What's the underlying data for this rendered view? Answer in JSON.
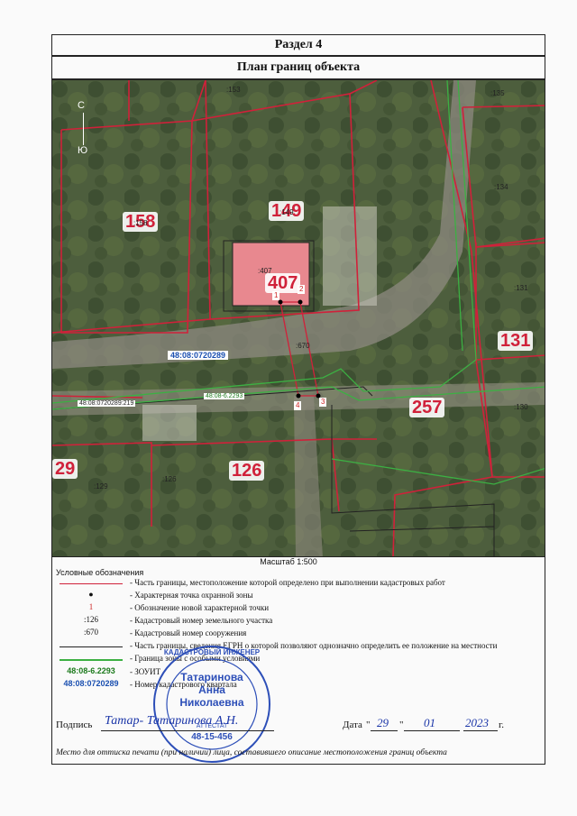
{
  "section_title": "Раздел 4",
  "plan_title": "План границ объекта",
  "compass": {
    "north": "С",
    "south": "Ю"
  },
  "map": {
    "parcel_labels": [
      {
        "big": "158",
        "small": ":158"
      },
      {
        "big": "149",
        "small": ":149"
      },
      {
        "big": "407",
        "small": ":407"
      },
      {
        "big": "131",
        "small": ":131"
      },
      {
        "big": "257",
        "small": ""
      },
      {
        "big": "126",
        "small": ":126"
      },
      {
        "big": "29",
        "small": ""
      }
    ],
    "small_labels": [
      ":153",
      ":135",
      ":134",
      ":130",
      ":129",
      ":670"
    ],
    "quarter_number": "48:08:0720289",
    "quarter_number_small": "48:08:0720289:219",
    "zone_number": "48:08-6.2293",
    "points": [
      "1",
      "2",
      "3",
      "4"
    ]
  },
  "scale_text": "Масштаб 1:500",
  "legend": {
    "title": "Условные обозначения",
    "items": [
      {
        "symbol": "",
        "text": "- Часть границы, местоположение которой определено при выполнении кадастровых работ"
      },
      {
        "symbol": "●",
        "text": "- Характерная точка охранной зоны"
      },
      {
        "symbol": "1",
        "text": "- Обозначение новой характерной точки"
      },
      {
        "symbol": ":126",
        "text": "- Кадастровый номер земельного участка"
      },
      {
        "symbol": ":670",
        "text": "- Кадастровый номер сооружения"
      },
      {
        "symbol": "",
        "text": "- Часть границы, сведения ЕГРН о которой позволяют однозначно определить ее положение на местности"
      },
      {
        "symbol": "",
        "text": "- Граница зоны с особыми условиями"
      },
      {
        "symbol": "48:08-6.2293",
        "text": "- ЗОУИТ"
      },
      {
        "symbol": "48:08:0720289",
        "text": "- Номер кадастрового квартала"
      }
    ]
  },
  "signature": {
    "label": "Подпись",
    "date_label": "Дата",
    "day": "29",
    "month": "01",
    "year": "2023",
    "year_suffix": "г.",
    "note": "Место для оттиска печати (при наличии) лица, составившего описание местоположения границ объекта",
    "stamp_name_1": "Татаринова",
    "stamp_name_2": "Анна",
    "stamp_name_3": "Николаевна",
    "stamp_attest": "АТТЕСТАТ",
    "stamp_number": "48-15-456",
    "stamp_ring": "КАДАСТРОВЫЙ ИНЖЕНЕР",
    "handwritten_signature": "Татар- Татаринова А.Н."
  },
  "colors": {
    "boundary_red": "#d0213a",
    "zone_green": "#3cb043",
    "quarter_blue": "#1a4fb0",
    "stamp_blue": "#2d4fb8"
  }
}
